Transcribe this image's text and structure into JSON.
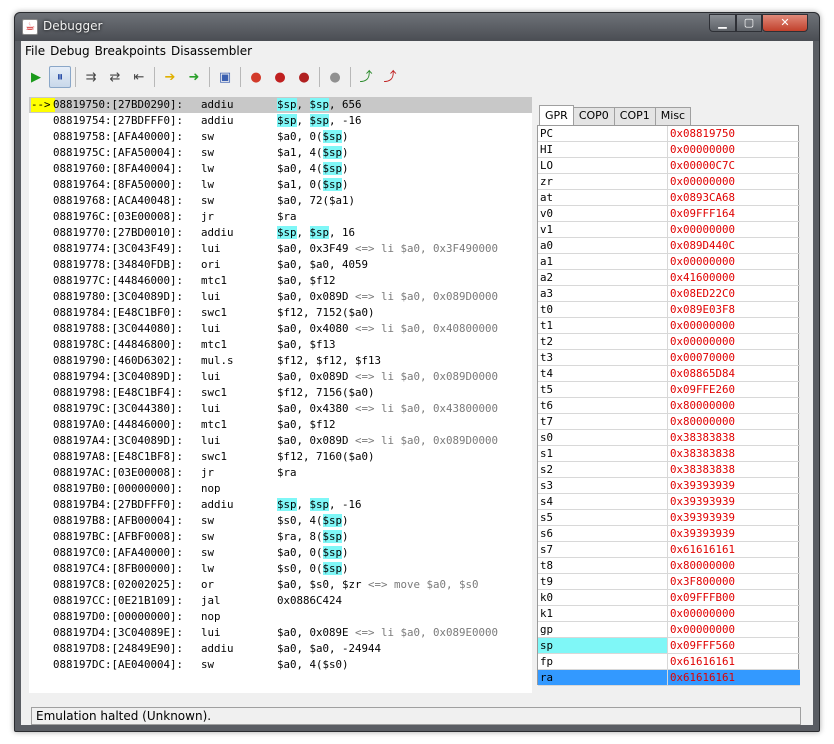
{
  "window": {
    "title": "Debugger"
  },
  "menu": [
    "File",
    "Debug",
    "Breakpoints",
    "Disassembler"
  ],
  "toolbar_icons": [
    {
      "name": "run-icon",
      "glyph": "▶",
      "color": "#1a9a1a"
    },
    {
      "name": "pause-icon",
      "glyph": "⏸",
      "color": "#2b4fa8",
      "pressed": true
    },
    {
      "name": "step-into-icon",
      "glyph": "⇉",
      "color": "#444"
    },
    {
      "name": "step-over-icon",
      "glyph": "⇄",
      "color": "#444"
    },
    {
      "name": "step-out-icon",
      "glyph": "⇤",
      "color": "#444"
    },
    {
      "name": "goto-pc-icon",
      "glyph": "➔",
      "color": "#e0b000"
    },
    {
      "name": "run-to-cursor-icon",
      "glyph": "➜",
      "color": "#2aa02a"
    },
    {
      "name": "memory-view-icon",
      "glyph": "▣",
      "color": "#3a5fb0"
    },
    {
      "name": "breakpoint-add-icon",
      "glyph": "●",
      "color": "#d23a2a"
    },
    {
      "name": "breakpoint-remove-icon",
      "glyph": "●",
      "color": "#c02020"
    },
    {
      "name": "breakpoint-clear-icon",
      "glyph": "●",
      "color": "#b02020"
    },
    {
      "name": "record-icon",
      "glyph": "●",
      "color": "#909090"
    },
    {
      "name": "export-icon",
      "glyph": "⤴",
      "color": "#2a8a2a"
    },
    {
      "name": "import-icon",
      "glyph": "⤴",
      "color": "#c02020"
    }
  ],
  "current_marker": "-->",
  "disassembly": [
    {
      "addr": "08819750:[27BD0290]:",
      "mn": "addiu",
      "ops": [
        [
          "$sp",
          true
        ],
        [
          ", ",
          false
        ],
        [
          "$sp",
          true
        ],
        [
          ", 656",
          false
        ]
      ],
      "current": true
    },
    {
      "addr": "08819754:[27BDFFF0]:",
      "mn": "addiu",
      "ops": [
        [
          "$sp",
          true
        ],
        [
          ", ",
          false
        ],
        [
          "$sp",
          true
        ],
        [
          ", -16",
          false
        ]
      ]
    },
    {
      "addr": "08819758:[AFA40000]:",
      "mn": "sw",
      "ops": [
        [
          "$a0, 0(",
          false
        ],
        [
          "$sp",
          true
        ],
        [
          ")",
          false
        ]
      ]
    },
    {
      "addr": "0881975C:[AFA50004]:",
      "mn": "sw",
      "ops": [
        [
          "$a1, 4(",
          false
        ],
        [
          "$sp",
          true
        ],
        [
          ")",
          false
        ]
      ]
    },
    {
      "addr": "08819760:[8FA40004]:",
      "mn": "lw",
      "ops": [
        [
          "$a0, 4(",
          false
        ],
        [
          "$sp",
          true
        ],
        [
          ")",
          false
        ]
      ]
    },
    {
      "addr": "08819764:[8FA50000]:",
      "mn": "lw",
      "ops": [
        [
          "$a1, 0(",
          false
        ],
        [
          "$sp",
          true
        ],
        [
          ")",
          false
        ]
      ]
    },
    {
      "addr": "08819768:[ACA40048]:",
      "mn": "sw",
      "ops": [
        [
          "$a0, 72($a1)",
          false
        ]
      ]
    },
    {
      "addr": "0881976C:[03E00008]:",
      "mn": "jr",
      "ops": [
        [
          "$ra",
          false
        ]
      ]
    },
    {
      "addr": "08819770:[27BD0010]:",
      "mn": "addiu",
      "ops": [
        [
          "$sp",
          true
        ],
        [
          ", ",
          false
        ],
        [
          "$sp",
          true
        ],
        [
          ", 16",
          false
        ]
      ]
    },
    {
      "addr": "08819774:[3C043F49]:",
      "mn": "lui",
      "ops": [
        [
          "$a0, 0x3F49",
          false
        ]
      ],
      "cmt": " <=> li $a0, 0x3F490000"
    },
    {
      "addr": "08819778:[34840FDB]:",
      "mn": "ori",
      "ops": [
        [
          "$a0, $a0, 4059",
          false
        ]
      ]
    },
    {
      "addr": "0881977C:[44846000]:",
      "mn": "mtc1",
      "ops": [
        [
          "$a0, $f12",
          false
        ]
      ]
    },
    {
      "addr": "08819780:[3C04089D]:",
      "mn": "lui",
      "ops": [
        [
          "$a0, 0x089D",
          false
        ]
      ],
      "cmt": " <=> li $a0, 0x089D0000"
    },
    {
      "addr": "08819784:[E48C1BF0]:",
      "mn": "swc1",
      "ops": [
        [
          "$f12, 7152($a0)",
          false
        ]
      ]
    },
    {
      "addr": "08819788:[3C044080]:",
      "mn": "lui",
      "ops": [
        [
          "$a0, 0x4080",
          false
        ]
      ],
      "cmt": " <=> li $a0, 0x40800000"
    },
    {
      "addr": "0881978C:[44846800]:",
      "mn": "mtc1",
      "ops": [
        [
          "$a0, $f13",
          false
        ]
      ]
    },
    {
      "addr": "08819790:[460D6302]:",
      "mn": "mul.s",
      "ops": [
        [
          "$f12, $f12, $f13",
          false
        ]
      ]
    },
    {
      "addr": "08819794:[3C04089D]:",
      "mn": "lui",
      "ops": [
        [
          "$a0, 0x089D",
          false
        ]
      ],
      "cmt": " <=> li $a0, 0x089D0000"
    },
    {
      "addr": "08819798:[E48C1BF4]:",
      "mn": "swc1",
      "ops": [
        [
          "$f12, 7156($a0)",
          false
        ]
      ]
    },
    {
      "addr": "0881979C:[3C044380]:",
      "mn": "lui",
      "ops": [
        [
          "$a0, 0x4380",
          false
        ]
      ],
      "cmt": " <=> li $a0, 0x43800000"
    },
    {
      "addr": "088197A0:[44846000]:",
      "mn": "mtc1",
      "ops": [
        [
          "$a0, $f12",
          false
        ]
      ]
    },
    {
      "addr": "088197A4:[3C04089D]:",
      "mn": "lui",
      "ops": [
        [
          "$a0, 0x089D",
          false
        ]
      ],
      "cmt": " <=> li $a0, 0x089D0000"
    },
    {
      "addr": "088197A8:[E48C1BF8]:",
      "mn": "swc1",
      "ops": [
        [
          "$f12, 7160($a0)",
          false
        ]
      ]
    },
    {
      "addr": "088197AC:[03E00008]:",
      "mn": "jr",
      "ops": [
        [
          "$ra",
          false
        ]
      ]
    },
    {
      "addr": "088197B0:[00000000]:",
      "mn": "nop",
      "ops": []
    },
    {
      "addr": "088197B4:[27BDFFF0]:",
      "mn": "addiu",
      "ops": [
        [
          "$sp",
          true
        ],
        [
          ", ",
          false
        ],
        [
          "$sp",
          true
        ],
        [
          ", -16",
          false
        ]
      ]
    },
    {
      "addr": "088197B8:[AFB00004]:",
      "mn": "sw",
      "ops": [
        [
          "$s0, 4(",
          false
        ],
        [
          "$sp",
          true
        ],
        [
          ")",
          false
        ]
      ]
    },
    {
      "addr": "088197BC:[AFBF0008]:",
      "mn": "sw",
      "ops": [
        [
          "$ra, 8(",
          false
        ],
        [
          "$sp",
          true
        ],
        [
          ")",
          false
        ]
      ]
    },
    {
      "addr": "088197C0:[AFA40000]:",
      "mn": "sw",
      "ops": [
        [
          "$a0, 0(",
          false
        ],
        [
          "$sp",
          true
        ],
        [
          ")",
          false
        ]
      ]
    },
    {
      "addr": "088197C4:[8FB00000]:",
      "mn": "lw",
      "ops": [
        [
          "$s0, 0(",
          false
        ],
        [
          "$sp",
          true
        ],
        [
          ")",
          false
        ]
      ]
    },
    {
      "addr": "088197C8:[02002025]:",
      "mn": "or",
      "ops": [
        [
          "$a0, $s0, $zr",
          false
        ]
      ],
      "cmt": " <=> move $a0, $s0"
    },
    {
      "addr": "088197CC:[0E21B109]:",
      "mn": "jal",
      "ops": [
        [
          "0x0886C424",
          false
        ]
      ]
    },
    {
      "addr": "088197D0:[00000000]:",
      "mn": "nop",
      "ops": []
    },
    {
      "addr": "088197D4:[3C04089E]:",
      "mn": "lui",
      "ops": [
        [
          "$a0, 0x089E",
          false
        ]
      ],
      "cmt": " <=> li $a0, 0x089E0000"
    },
    {
      "addr": "088197D8:[24849E90]:",
      "mn": "addiu",
      "ops": [
        [
          "$a0, $a0, -24944",
          false
        ]
      ]
    },
    {
      "addr": "088197DC:[AE040004]:",
      "mn": "sw",
      "ops": [
        [
          "$a0, 4($s0)",
          false
        ]
      ]
    }
  ],
  "tabs": [
    "GPR",
    "COP0",
    "COP1",
    "Misc"
  ],
  "registers": [
    {
      "name": "PC",
      "value": "0x08819750"
    },
    {
      "name": "HI",
      "value": "0x00000000"
    },
    {
      "name": "LO",
      "value": "0x00000C7C"
    },
    {
      "name": "zr",
      "value": "0x00000000"
    },
    {
      "name": "at",
      "value": "0x0893CA68"
    },
    {
      "name": "v0",
      "value": "0x09FFF164"
    },
    {
      "name": "v1",
      "value": "0x00000000"
    },
    {
      "name": "a0",
      "value": "0x089D440C"
    },
    {
      "name": "a1",
      "value": "0x00000000"
    },
    {
      "name": "a2",
      "value": "0x41600000"
    },
    {
      "name": "a3",
      "value": "0x08ED22C0"
    },
    {
      "name": "t0",
      "value": "0x089E03F8"
    },
    {
      "name": "t1",
      "value": "0x00000000"
    },
    {
      "name": "t2",
      "value": "0x00000000"
    },
    {
      "name": "t3",
      "value": "0x00070000"
    },
    {
      "name": "t4",
      "value": "0x08865D84"
    },
    {
      "name": "t5",
      "value": "0x09FFE260"
    },
    {
      "name": "t6",
      "value": "0x80000000"
    },
    {
      "name": "t7",
      "value": "0x80000000"
    },
    {
      "name": "s0",
      "value": "0x38383838"
    },
    {
      "name": "s1",
      "value": "0x38383838"
    },
    {
      "name": "s2",
      "value": "0x38383838"
    },
    {
      "name": "s3",
      "value": "0x39393939"
    },
    {
      "name": "s4",
      "value": "0x39393939"
    },
    {
      "name": "s5",
      "value": "0x39393939"
    },
    {
      "name": "s6",
      "value": "0x39393939"
    },
    {
      "name": "s7",
      "value": "0x61616161"
    },
    {
      "name": "t8",
      "value": "0x80000000"
    },
    {
      "name": "t9",
      "value": "0x3F800000"
    },
    {
      "name": "k0",
      "value": "0x09FFFB00"
    },
    {
      "name": "k1",
      "value": "0x00000000"
    },
    {
      "name": "gp",
      "value": "0x00000000"
    },
    {
      "name": "sp",
      "value": "0x09FFF560"
    },
    {
      "name": "fp",
      "value": "0x61616161"
    },
    {
      "name": "ra",
      "value": "0x61616161"
    }
  ],
  "colors": {
    "reg_value": "#e00000",
    "sp_highlight": "#7ff7f7",
    "selected_row": "#3399ff",
    "marker": "#ffff00"
  },
  "status": "Emulation halted (Unknown)."
}
